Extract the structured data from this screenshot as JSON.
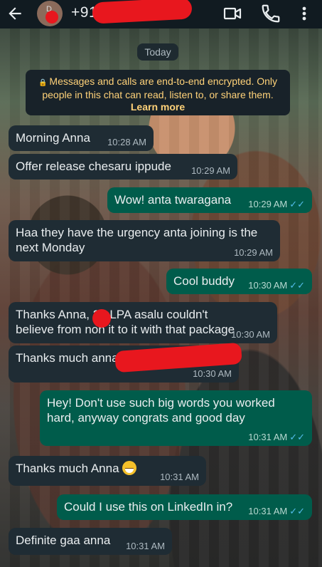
{
  "header": {
    "contact_name": "+91",
    "avatar_letter": "D",
    "back_icon": "arrow-left-icon",
    "video_icon": "video-call-icon",
    "call_icon": "phone-icon",
    "menu_icon": "more-vert-icon"
  },
  "date_chip": "Today",
  "encryption": {
    "line1": "Messages and calls are end-to-end encrypted. Only",
    "line2": "people in this chat can read, listen to, or share them.",
    "link": "Learn more"
  },
  "messages": [
    {
      "dir": "in",
      "text": "Morning Anna",
      "time": "10:28 AM"
    },
    {
      "dir": "in",
      "text": "Offer release chesaru ippude",
      "time": "10:29 AM"
    },
    {
      "dir": "out",
      "text": "Wow! anta twaragana",
      "time": "10:29 AM"
    },
    {
      "dir": "in",
      "text": "Haa they have the urgency anta joining is the next Monday",
      "time": "10:29 AM"
    },
    {
      "dir": "out",
      "text": "Cool buddy",
      "time": "10:30 AM"
    },
    {
      "dir": "in",
      "text": "Thanks Anna, 20 LPA asalu couldn't believe from non it to it with that package",
      "time": "10:30 AM"
    },
    {
      "dir": "in",
      "text": "Thanks much anna",
      "time": "10:30 AM"
    },
    {
      "dir": "out",
      "text": "Hey! Don't use such big words you worked hard, anyway congrats and good day",
      "time": "10:31 AM"
    },
    {
      "dir": "in",
      "text": "Thanks much Anna",
      "time": "10:31 AM"
    },
    {
      "dir": "out",
      "text": "Could I use this on LinkedIn in?",
      "time": "10:31 AM"
    },
    {
      "dir": "in",
      "text": "Definite gaa anna",
      "time": "10:31 AM"
    }
  ],
  "colors": {
    "header_bg": "#111b21",
    "incoming_bubble": "#1f2c34",
    "outgoing_bubble": "#005c4b",
    "read_ticks": "#53bdeb",
    "encryption_text": "#ffd279",
    "redaction": "#e8171e"
  }
}
